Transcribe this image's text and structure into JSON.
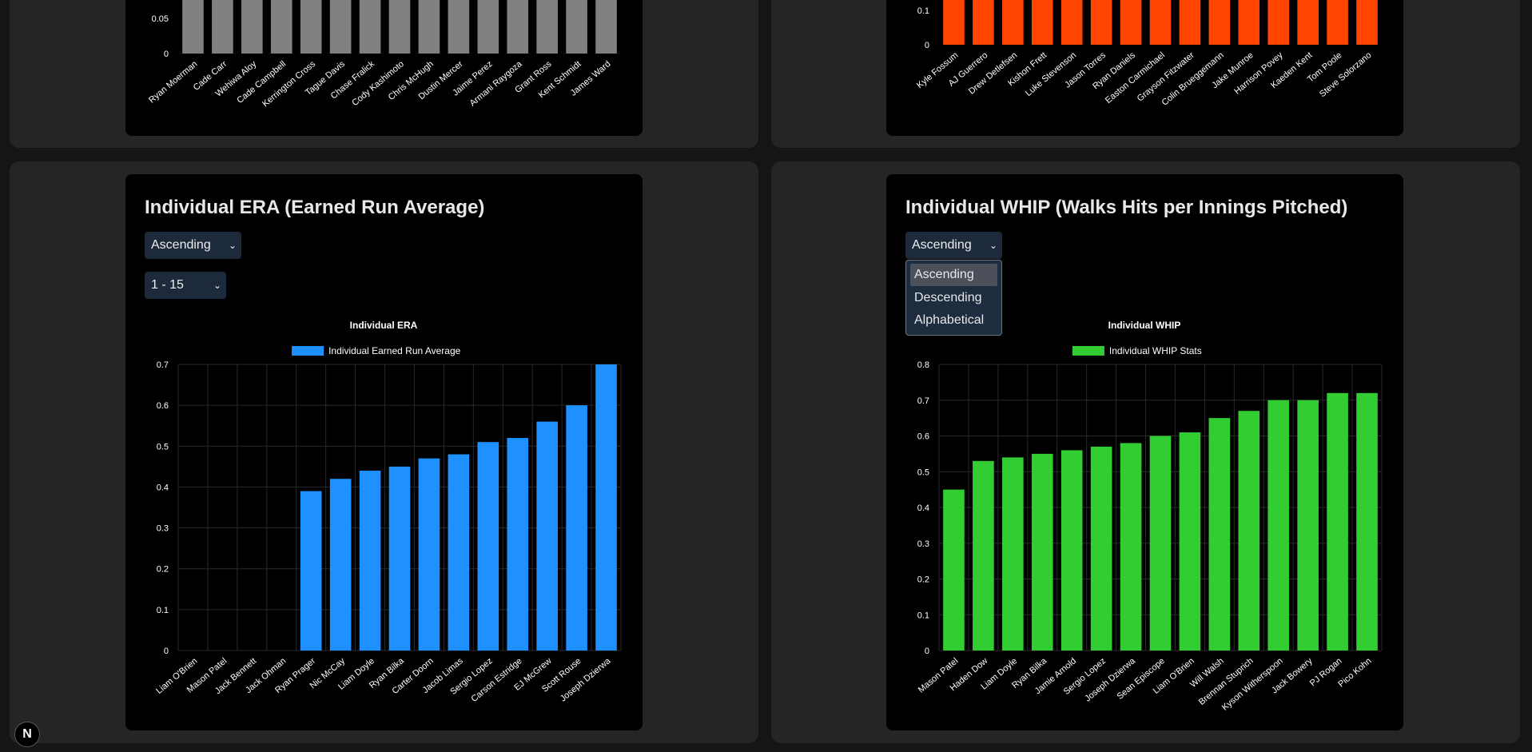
{
  "top_left_chart": {
    "y_ticks": [
      "0.05",
      "0"
    ],
    "bar_color": "#808080",
    "categories": [
      "Ryan Moerman",
      "Cade Carr",
      "Wehiwa Aloy",
      "Cade Campbell",
      "Kerrington Cross",
      "Tague Davis",
      "Chase Fralick",
      "Cody Kashimoto",
      "Chris McHugh",
      "Dustin Mercer",
      "Jaime Perez",
      "Armani Raygoza",
      "Grant Ross",
      "Kent Schmidt",
      "James Ward"
    ]
  },
  "top_right_chart": {
    "y_ticks": [
      "0.1",
      "0"
    ],
    "bar_color": "#ff4500",
    "categories": [
      "Kyle Fossum",
      "AJ Guerrero",
      "Drew Detlefsen",
      "Kishon Frett",
      "Luke Stevenson",
      "Jason Torres",
      "Ryan Daniels",
      "Easton Carmichael",
      "Grayson Fitzwater",
      "Colin Brueggemann",
      "Jake Munroe",
      "Harrison Povey",
      "Kaeden Kent",
      "Tom Poole",
      "Steve Solorzano"
    ]
  },
  "era_card": {
    "title": "Individual ERA (Earned Run Average)",
    "sort_select": "Ascending",
    "range_select": "1 - 15"
  },
  "whip_card": {
    "title": "Individual WHIP (Walks Hits per Innings Pitched)",
    "sort_select": "Ascending",
    "sort_options": [
      "Ascending",
      "Descending",
      "Alphabetical"
    ]
  },
  "chart_data": [
    {
      "type": "bar",
      "title": "Individual ERA",
      "series": [
        {
          "name": "Individual Earned Run Average",
          "color": "#1e90ff",
          "values": [
            0,
            0,
            0,
            0,
            0.39,
            0.42,
            0.44,
            0.45,
            0.47,
            0.48,
            0.51,
            0.52,
            0.56,
            0.6,
            0.7
          ]
        }
      ],
      "categories": [
        "Liam O'Brien",
        "Mason Patel",
        "Jack Bennett",
        "Jack Ohman",
        "Ryan Prager",
        "Nic McCay",
        "Liam Doyle",
        "Ryan Bilka",
        "Carter Doorn",
        "Jacob Limas",
        "Sergio Lopez",
        "Carson Estridge",
        "EJ McGrew",
        "Scott Rouse",
        "Joseph Dzierwa"
      ],
      "y_ticks": [
        "0",
        "0.1",
        "0.2",
        "0.3",
        "0.4",
        "0.5",
        "0.6",
        "0.7"
      ],
      "ylim": [
        0,
        0.7
      ],
      "grid": true,
      "legend": "top-center"
    },
    {
      "type": "bar",
      "title": "Individual WHIP",
      "series": [
        {
          "name": "Individual WHIP Stats",
          "color": "#32cd32",
          "values": [
            0.45,
            0.53,
            0.54,
            0.55,
            0.56,
            0.57,
            0.58,
            0.6,
            0.61,
            0.65,
            0.67,
            0.7,
            0.7,
            0.72,
            0.72
          ]
        }
      ],
      "categories": [
        "Mason Patel",
        "Haden Dow",
        "Liam Doyle",
        "Ryan Bilka",
        "Jamie Arnold",
        "Sergio Lopez",
        "Joseph Dzierwa",
        "Sean Episcope",
        "Liam O'Brien",
        "Will Walsh",
        "Brennan Stuprich",
        "Kyson Witherspoon",
        "Jack Bowery",
        "PJ Rogan",
        "Pico Kohn"
      ],
      "y_ticks": [
        "0",
        "0.1",
        "0.2",
        "0.3",
        "0.4",
        "0.5",
        "0.6",
        "0.7",
        "0.8"
      ],
      "ylim": [
        0,
        0.8
      ],
      "grid": true,
      "legend": "top-center"
    }
  ],
  "next_badge": "N"
}
